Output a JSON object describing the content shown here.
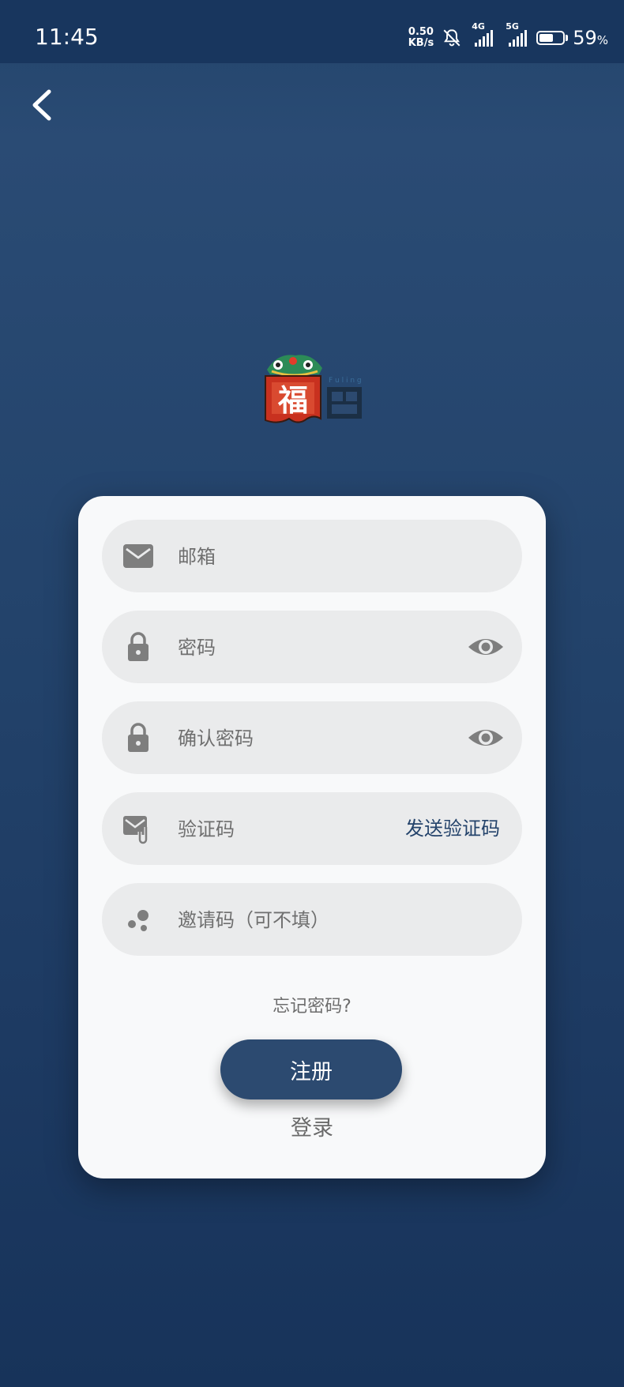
{
  "status_bar": {
    "time": "11:45",
    "net_speed_value": "0.50",
    "net_speed_unit": "KB/s",
    "signal_1_label": "4G",
    "signal_2_label": "5G",
    "battery_level": 0.59,
    "battery_percent": "59",
    "battery_percent_sign": "%"
  },
  "icons": {
    "back": "back-arrow-icon",
    "email": "envelope-icon",
    "password": "lock-icon",
    "visibility": "eye-icon",
    "code": "mail-attachment-icon",
    "invite": "dots-icon"
  },
  "form": {
    "email_placeholder": "邮箱",
    "password_placeholder": "密码",
    "confirm_password_placeholder": "确认密码",
    "code_placeholder": "验证码",
    "send_code_label": "发送验证码",
    "invite_placeholder": "邀请码（可不填）",
    "forgot_label": "忘记密码?",
    "register_label": "注册",
    "login_label": "登录"
  },
  "colors": {
    "background": "#23436b",
    "card": "#f8f9fa",
    "field": "#eaebec",
    "button": "#2c4a70",
    "link": "#24436b",
    "icon": "#7e7e7e"
  }
}
